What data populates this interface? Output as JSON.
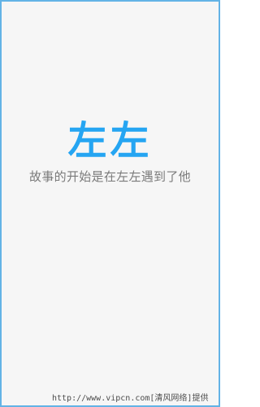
{
  "splash": {
    "logo_text": "左左",
    "slogan": "故事的开始是在左左遇到了他"
  },
  "watermark": {
    "text": "http://www.vipcn.com[清风网络]提供"
  },
  "colors": {
    "logo": "#25a5f2",
    "slogan": "#7a7a7a",
    "background": "#f6f6f6",
    "frame_border": "#63b3e6"
  }
}
